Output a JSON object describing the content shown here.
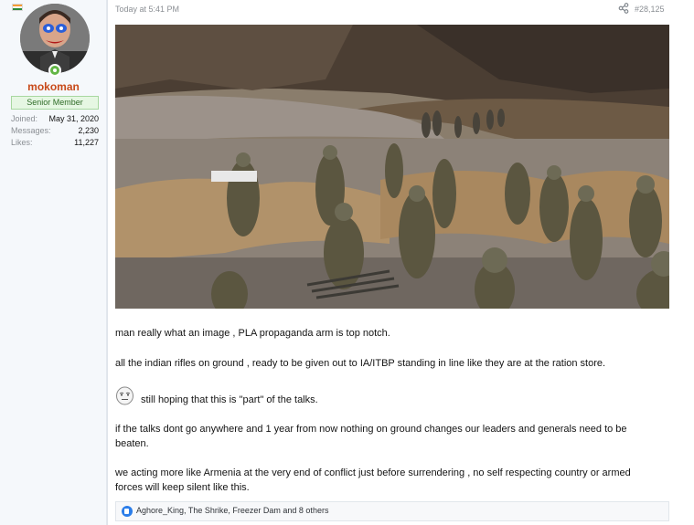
{
  "user": {
    "flag": "india-flag-icon",
    "name": "mokoman",
    "title": "Senior Member",
    "stats": [
      {
        "key": "Joined:",
        "value": "May 31, 2020"
      },
      {
        "key": "Messages:",
        "value": "2,230"
      },
      {
        "key": "Likes:",
        "value": "11,227"
      }
    ],
    "status": "online"
  },
  "post": {
    "time": "Today at 5:41 PM",
    "number": "#28,125",
    "paragraphs": [
      "man really what an image , PLA propaganda arm is top notch.",
      "all the indian rifles on ground , ready to be given out to IA/ITBP standing in line like they are at the ration store.",
      "still hoping that this is \"part\" of the talks.",
      "if the talks dont go anywhere and 1 year from now nothing on ground changes our leaders and generals need to be beaten.",
      "we acting more like Armenia at the very end of conflict just before surrendering , no self respecting country or armed forces will keep silent like this."
    ],
    "likes": "Aghore_King, The Shrike, Freezer Dam and 8 others"
  },
  "colors": {
    "username": "#c84a1a",
    "title_bg": "#e6f7e3",
    "like_icon": "#2b7de9"
  }
}
